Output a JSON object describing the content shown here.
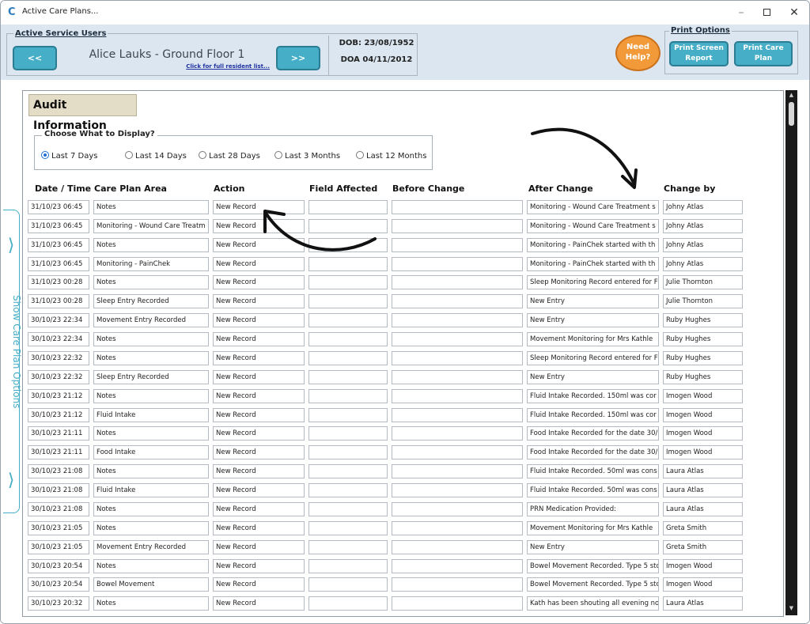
{
  "window": {
    "title": "Active Care Plans..."
  },
  "header": {
    "service_users_label": "Active Service Users",
    "prev_label": "<<",
    "next_label": ">>",
    "resident_name": "Alice Lauks - Ground Floor 1",
    "resident_link": "Click for full resident list...",
    "dob": "DOB: 23/08/1952",
    "doa": "DOA 04/11/2012",
    "help_line1": "Need",
    "help_line2": "Help?",
    "print_options_label": "Print Options",
    "print_screen_line1": "Print Screen",
    "print_screen_line2": "Report",
    "print_care_line1": "Print Care",
    "print_care_line2": "Plan"
  },
  "side_tab": {
    "label": "Show Care Plan Options"
  },
  "audit": {
    "title": "Audit Information",
    "choose_label": "Choose What to Display?",
    "ranges": [
      {
        "label": "Last 7 Days",
        "selected": true
      },
      {
        "label": "Last 14 Days",
        "selected": false
      },
      {
        "label": "Last 28 Days",
        "selected": false
      },
      {
        "label": "Last 3 Months",
        "selected": false
      },
      {
        "label": "Last 12 Months",
        "selected": false
      }
    ],
    "columns": {
      "date": "Date / Time",
      "area": "Care Plan Area",
      "action": "Action",
      "field": "Field Affected",
      "before": "Before Change",
      "after": "After Change",
      "by": "Change by"
    },
    "rows": [
      {
        "date": "31/10/23 06:45",
        "area": "Notes",
        "action": "New Record",
        "field": "",
        "before": "",
        "after": "Monitoring - Wound Care Treatment s",
        "by": "Johny Atlas"
      },
      {
        "date": "31/10/23 06:45",
        "area": "Monitoring - Wound Care Treatm",
        "action": "New Record",
        "field": "",
        "before": "",
        "after": "Monitoring - Wound Care Treatment s",
        "by": "Johny Atlas"
      },
      {
        "date": "31/10/23 06:45",
        "area": "Notes",
        "action": "New Record",
        "field": "",
        "before": "",
        "after": "Monitoring - PainChek started with th",
        "by": "Johny Atlas"
      },
      {
        "date": "31/10/23 06:45",
        "area": "Monitoring - PainChek",
        "action": "New Record",
        "field": "",
        "before": "",
        "after": "Monitoring - PainChek started with th",
        "by": "Johny Atlas"
      },
      {
        "date": "31/10/23 00:28",
        "area": "Notes",
        "action": "New Record",
        "field": "",
        "before": "",
        "after": "Sleep Monitoring Record entered for F",
        "by": "Julie Thornton"
      },
      {
        "date": "31/10/23 00:28",
        "area": "Sleep Entry Recorded",
        "action": "New Record",
        "field": "",
        "before": "",
        "after": "New Entry",
        "by": "Julie Thornton"
      },
      {
        "date": "30/10/23 22:34",
        "area": "Movement Entry Recorded",
        "action": "New Record",
        "field": "",
        "before": "",
        "after": "New Entry",
        "by": "Ruby Hughes"
      },
      {
        "date": "30/10/23 22:34",
        "area": "Notes",
        "action": "New Record",
        "field": "",
        "before": "",
        "after": "Movement Monitoring for Mrs Kathle",
        "by": "Ruby Hughes"
      },
      {
        "date": "30/10/23 22:32",
        "area": "Notes",
        "action": "New Record",
        "field": "",
        "before": "",
        "after": "Sleep Monitoring Record entered for F",
        "by": "Ruby Hughes"
      },
      {
        "date": "30/10/23 22:32",
        "area": "Sleep Entry Recorded",
        "action": "New Record",
        "field": "",
        "before": "",
        "after": "New Entry",
        "by": "Ruby Hughes"
      },
      {
        "date": "30/10/23 21:12",
        "area": "Notes",
        "action": "New Record",
        "field": "",
        "before": "",
        "after": "Fluid Intake Recorded. 150ml was cor",
        "by": "Imogen Wood"
      },
      {
        "date": "30/10/23 21:12",
        "area": "Fluid Intake",
        "action": "New Record",
        "field": "",
        "before": "",
        "after": "Fluid Intake Recorded. 150ml was cor",
        "by": "Imogen Wood"
      },
      {
        "date": "30/10/23 21:11",
        "area": "Notes",
        "action": "New Record",
        "field": "",
        "before": "",
        "after": "Food Intake Recorded for the date 30/",
        "by": "Imogen Wood"
      },
      {
        "date": "30/10/23 21:11",
        "area": "Food Intake",
        "action": "New Record",
        "field": "",
        "before": "",
        "after": "Food Intake Recorded for the date 30/",
        "by": "Imogen Wood"
      },
      {
        "date": "30/10/23 21:08",
        "area": "Notes",
        "action": "New Record",
        "field": "",
        "before": "",
        "after": "Fluid Intake Recorded. 50ml was cons",
        "by": "Laura Atlas"
      },
      {
        "date": "30/10/23 21:08",
        "area": "Fluid Intake",
        "action": "New Record",
        "field": "",
        "before": "",
        "after": "Fluid Intake Recorded. 50ml was cons",
        "by": "Laura Atlas"
      },
      {
        "date": "30/10/23 21:08",
        "area": "Notes",
        "action": "New Record",
        "field": "",
        "before": "",
        "after": "PRN Medication Provided:",
        "by": "Laura Atlas"
      },
      {
        "date": "30/10/23 21:05",
        "area": "Notes",
        "action": "New Record",
        "field": "",
        "before": "",
        "after": "Movement Monitoring for Mrs Kathle",
        "by": "Greta Smith"
      },
      {
        "date": "30/10/23 21:05",
        "area": "Movement Entry Recorded",
        "action": "New Record",
        "field": "",
        "before": "",
        "after": "New Entry",
        "by": "Greta Smith"
      },
      {
        "date": "30/10/23 20:54",
        "area": "Notes",
        "action": "New Record",
        "field": "",
        "before": "",
        "after": "Bowel Movement Recorded. Type 5 sto",
        "by": "Imogen Wood"
      },
      {
        "date": "30/10/23 20:54",
        "area": "Bowel Movement",
        "action": "New Record",
        "field": "",
        "before": "",
        "after": "Bowel Movement Recorded. Type 5 sto",
        "by": "Imogen Wood"
      },
      {
        "date": "30/10/23 20:32",
        "area": "Notes",
        "action": "New Record",
        "field": "",
        "before": "",
        "after": "Kath has been shouting all evening no",
        "by": "Laura Atlas"
      }
    ]
  }
}
